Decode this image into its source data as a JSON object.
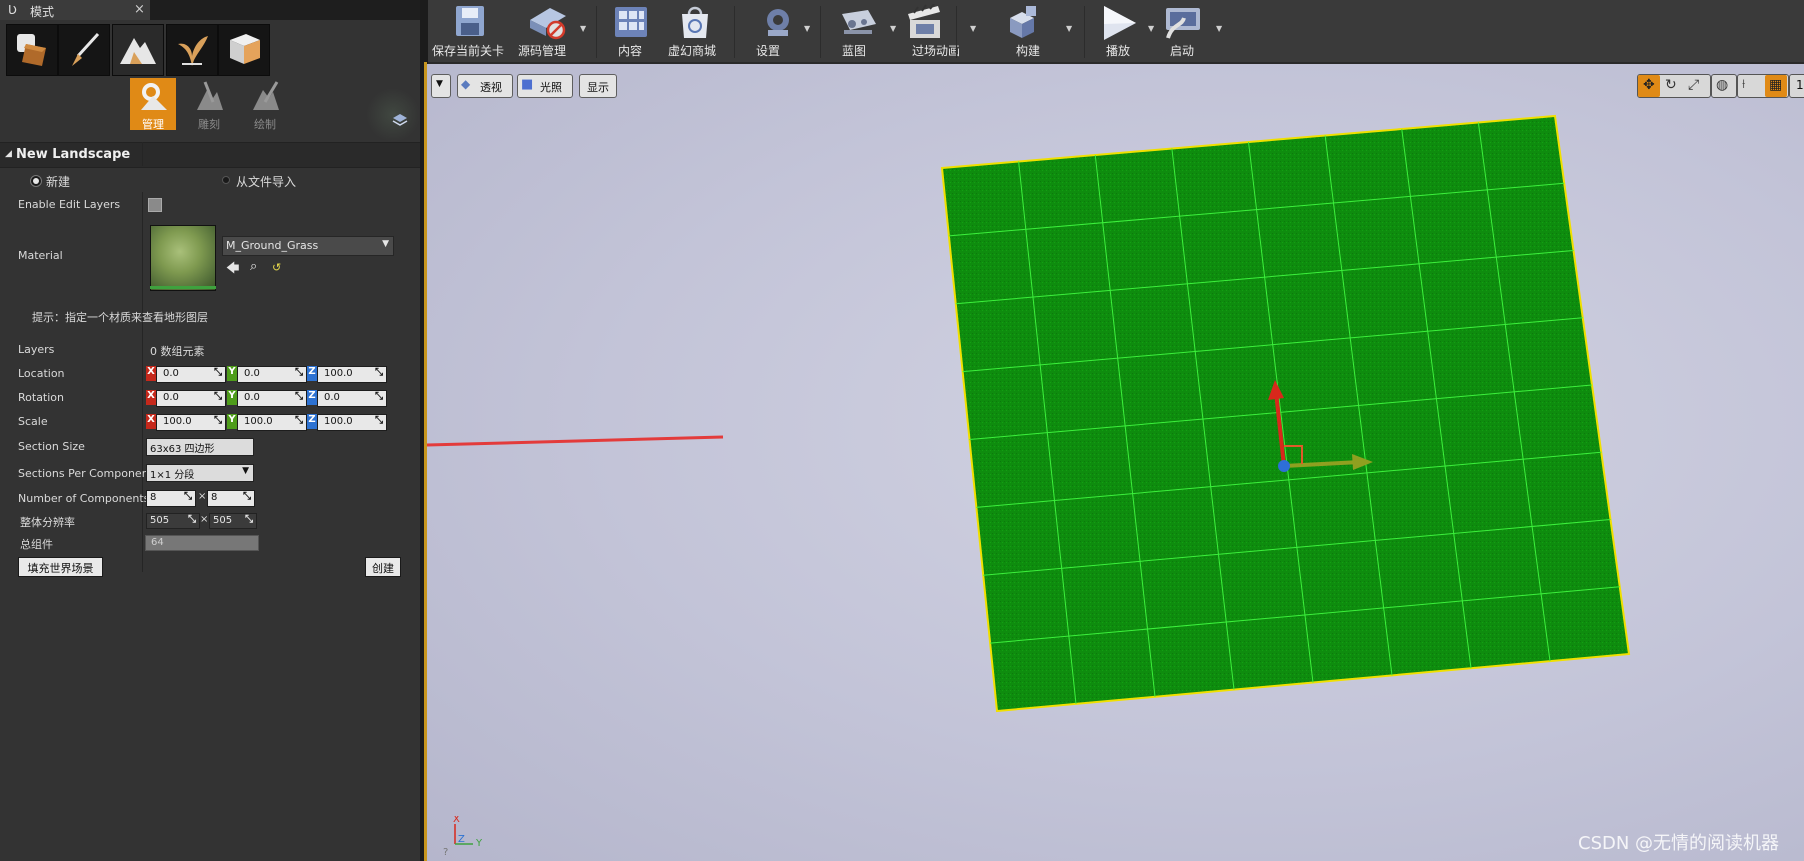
{
  "tab": {
    "title": "模式",
    "close_glyph": "×"
  },
  "mode_tools": [
    "place-mode",
    "paint-mode",
    "landscape-mode",
    "foliage-mode",
    "geometry-mode"
  ],
  "landscape_tools": [
    {
      "label": "管理",
      "active": true
    },
    {
      "label": "雕刻",
      "active": false
    },
    {
      "label": "绘制",
      "active": false
    }
  ],
  "section": {
    "title": "New Landscape"
  },
  "import": {
    "new_label": "新建",
    "file_label": "从文件导入",
    "selected": "new"
  },
  "props": {
    "enable_edit_layers": "Enable Edit Layers",
    "material": "Material",
    "material_value": "M_Ground_Grass",
    "hint": "提示：指定一个材质来查看地形图层",
    "layers": "Layers",
    "layers_value": "0 数组元素",
    "location": "Location",
    "rotation": "Rotation",
    "scale": "Scale",
    "section_size": "Section Size",
    "section_size_value": "63x63 四边形",
    "sections_per_component": "Sections Per Component",
    "sections_per_component_value": "1×1 分段",
    "number_of_components": "Number of Components",
    "resolution": "整体分辨率",
    "total_components": "总组件"
  },
  "location": {
    "x": "0.0",
    "y": "0.0",
    "z": "100.0"
  },
  "rotation": {
    "x": "0.0",
    "y": "0.0",
    "z": "0.0"
  },
  "scale": {
    "x": "100.0",
    "y": "100.0",
    "z": "100.0"
  },
  "axis_letters": {
    "x": "X",
    "y": "Y",
    "z": "Z"
  },
  "components": {
    "x": "8",
    "y": "8",
    "sep": "×"
  },
  "resolution": {
    "x": "505",
    "y": "505",
    "sep": "×"
  },
  "total_components": "64",
  "buttons": {
    "fill_world": "填充世界场景",
    "create": "创建"
  },
  "toolbar": [
    {
      "label": "保存当前关卡",
      "icon": "save-icon"
    },
    {
      "label": "源码管理",
      "icon": "source-control-icon"
    },
    {
      "label": "内容",
      "icon": "content-icon"
    },
    {
      "label": "虚幻商城",
      "icon": "marketplace-icon"
    },
    {
      "label": "设置",
      "icon": "settings-icon"
    },
    {
      "label": "蓝图",
      "icon": "blueprint-icon"
    },
    {
      "label": "过场动画",
      "icon": "cinematics-icon"
    },
    {
      "label": "构建",
      "icon": "build-icon"
    },
    {
      "label": "播放",
      "icon": "play-icon"
    },
    {
      "label": "启动",
      "icon": "launch-icon"
    }
  ],
  "viewport": {
    "perspective": "透视",
    "lit": "光照",
    "show": "显示",
    "grid_value": "1"
  },
  "axes_indicator": {
    "x": "X",
    "y": "Y",
    "z": "Z"
  },
  "watermark": "CSDN @无情的阅读机器",
  "colors": {
    "accent": "#e08a16",
    "landscape_green": "#0f8f0f",
    "grid_line": "#3cf03c",
    "border_yellow": "#f0e000",
    "arrow_red": "#e33b3b"
  }
}
